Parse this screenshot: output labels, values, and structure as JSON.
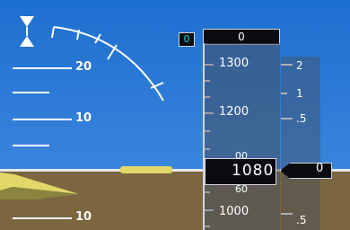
{
  "pfd": {
    "pitch_ladder": [
      "20",
      "10",
      "10"
    ],
    "altitude": {
      "selected_marker": "0",
      "selected_altitude": "0",
      "tape_labels": [
        "1300",
        "1200",
        "1000"
      ],
      "current": "1080",
      "roll_top": "00",
      "roll_bottom": "60"
    },
    "vsi": {
      "labels": [
        "2",
        "1",
        ".5",
        ".5"
      ],
      "pointer_value": "0"
    }
  }
}
